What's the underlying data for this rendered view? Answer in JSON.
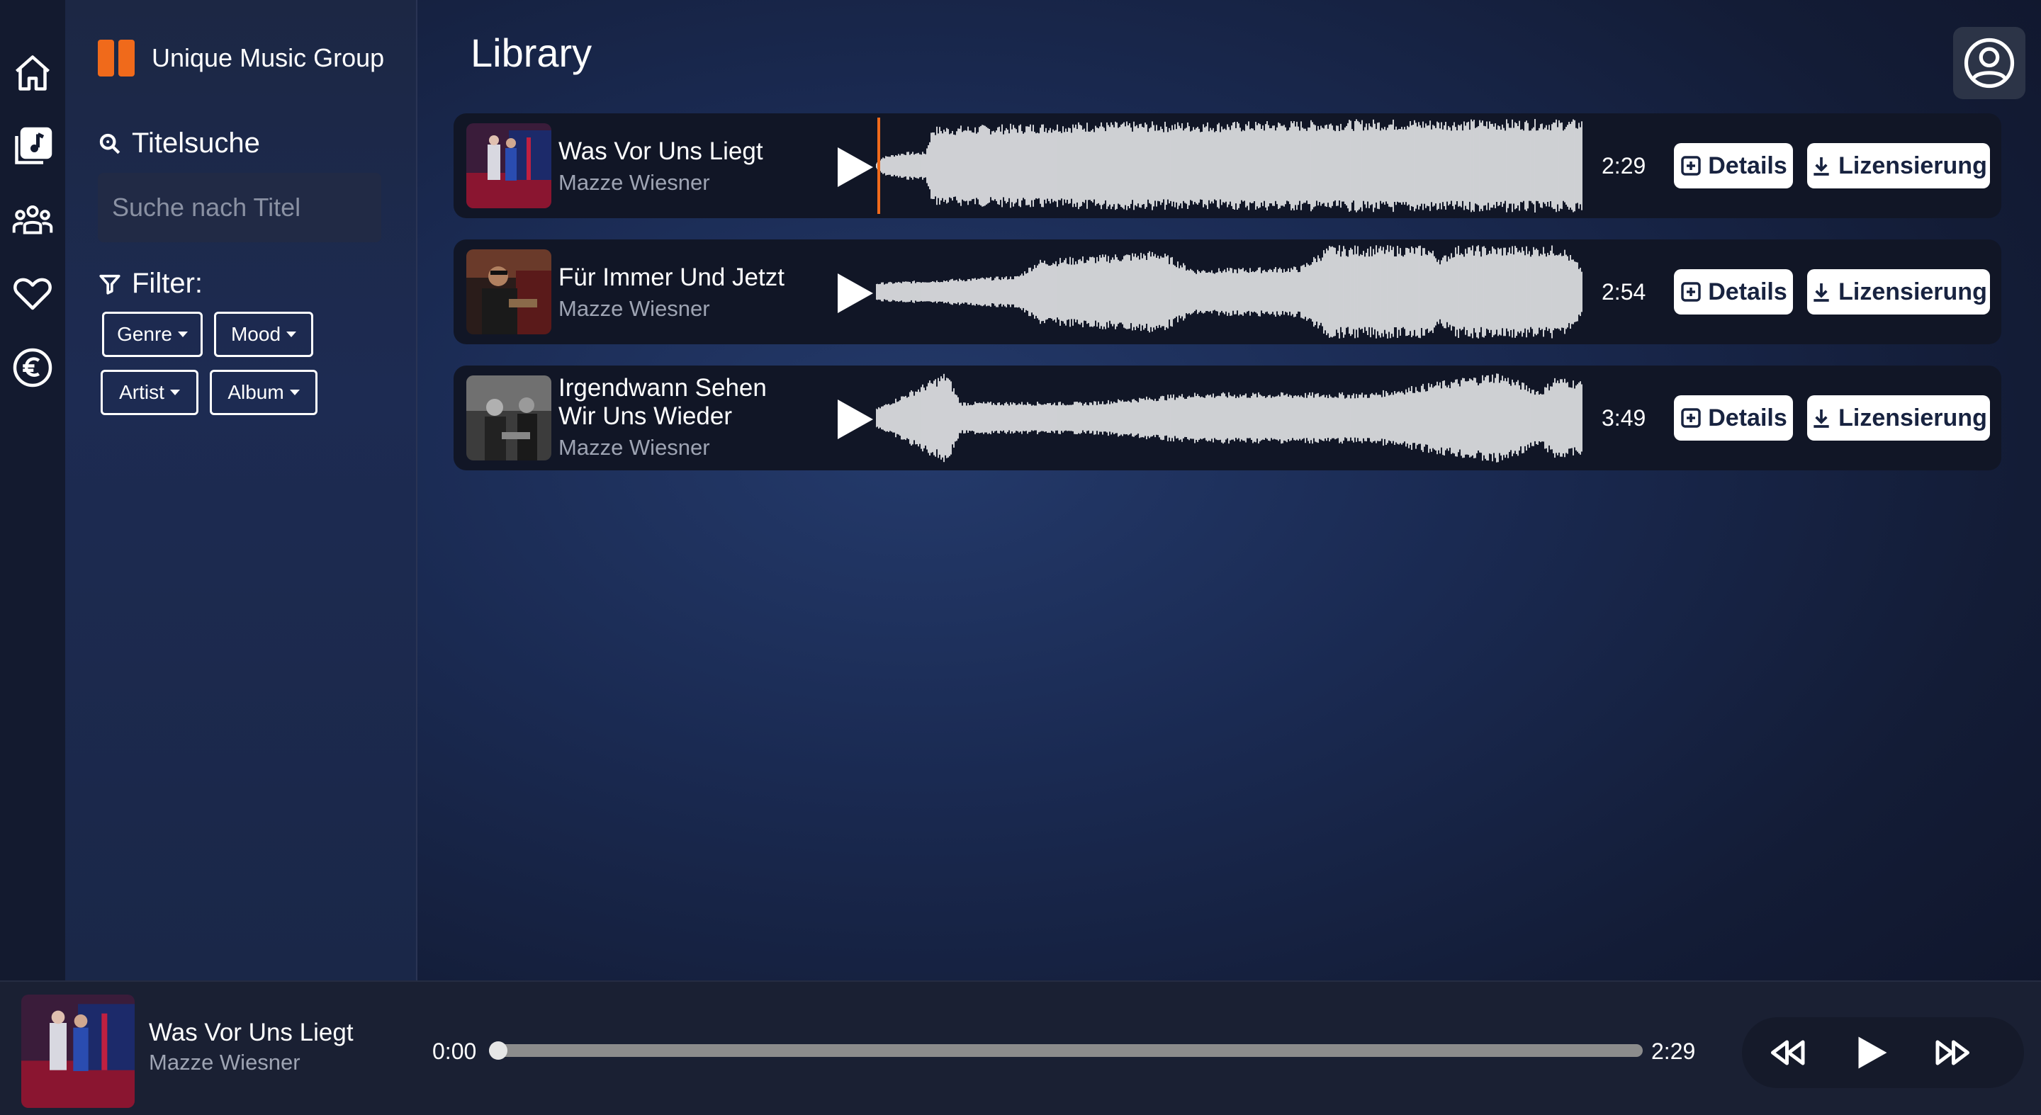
{
  "nav": {
    "items": [
      {
        "name": "home-icon"
      },
      {
        "name": "music-library-icon"
      },
      {
        "name": "artists-icon"
      },
      {
        "name": "favorites-icon"
      },
      {
        "name": "euro-icon"
      }
    ]
  },
  "brand": {
    "name": "Unique Music Group",
    "logo_color": "#f06a1b"
  },
  "search": {
    "title": "Titelsuche",
    "placeholder": "Suche nach Titel",
    "value": ""
  },
  "filter": {
    "title": "Filter:",
    "buttons": [
      "Genre",
      "Mood",
      "Artist",
      "Album"
    ]
  },
  "page": {
    "title": "Library"
  },
  "tracks": [
    {
      "title": "Was Vor Uns Liegt",
      "artist": "Mazze Wiesner",
      "duration": "2:29",
      "details_label": "Details",
      "license_label": "Lizensierung"
    },
    {
      "title": "Für Immer Und Jetzt",
      "artist": "Mazze Wiesner",
      "duration": "2:54",
      "details_label": "Details",
      "license_label": "Lizensierung"
    },
    {
      "title_line1": "Irgendwann Sehen",
      "title_line2": "Wir Uns Wieder",
      "artist": "Mazze Wiesner",
      "duration": "3:49",
      "details_label": "Details",
      "license_label": "Lizensierung"
    }
  ],
  "player": {
    "title": "Was Vor Uns Liegt",
    "artist": "Mazze Wiesner",
    "current_time": "0:00",
    "total_time": "2:29",
    "progress": 0.0
  },
  "colors": {
    "accent": "#f06a1b",
    "button_text": "#182340"
  }
}
